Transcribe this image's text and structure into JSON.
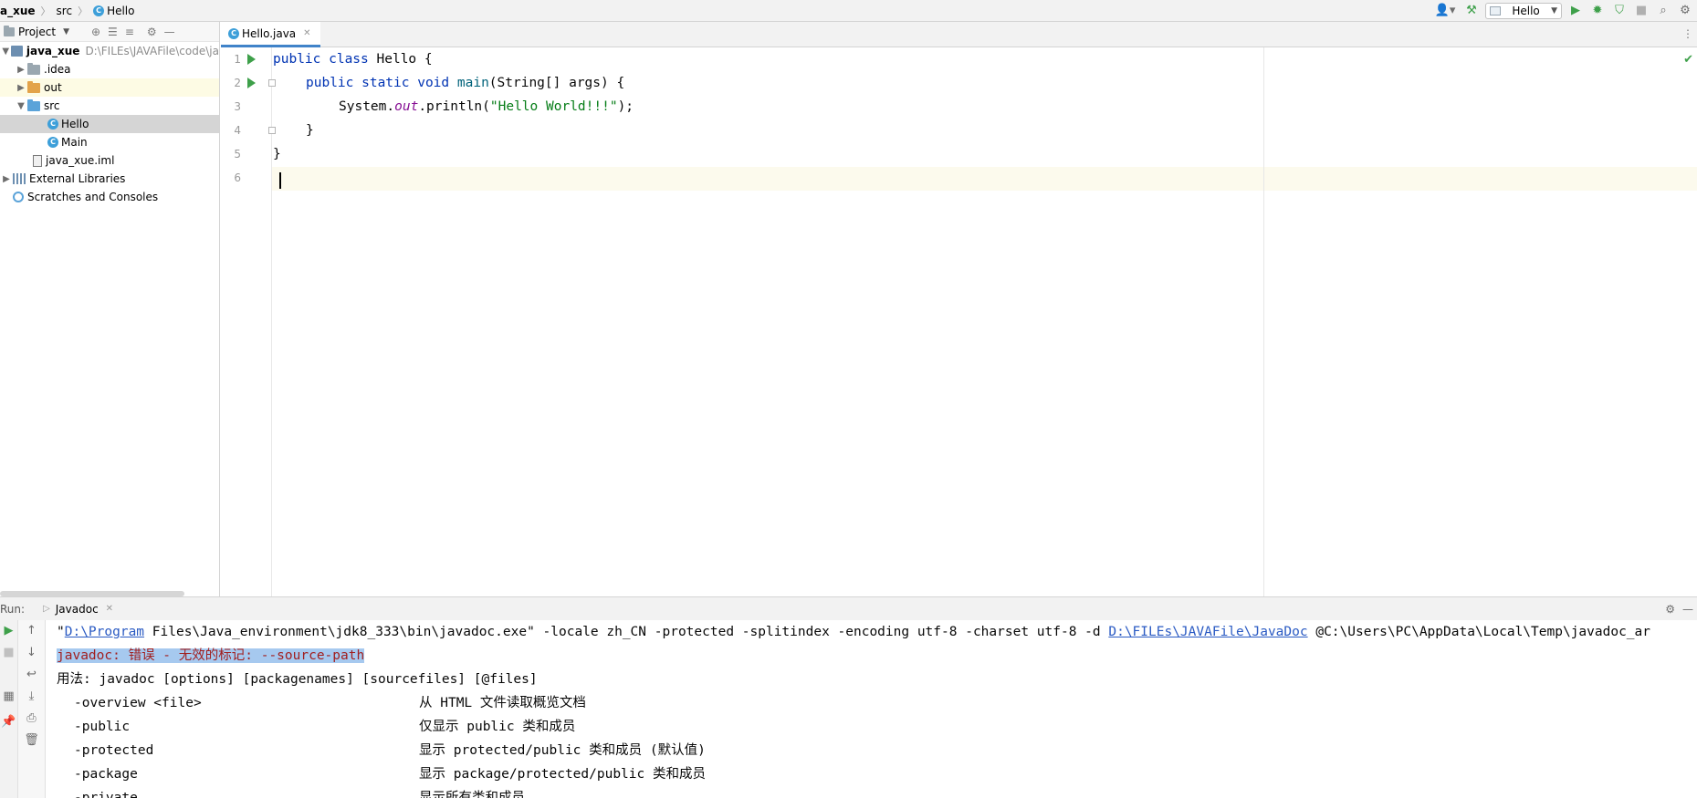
{
  "breadcrumb": [
    "a_xue",
    "src",
    "Hello"
  ],
  "run_config": {
    "label": "Hello"
  },
  "project": {
    "header_label": "Project",
    "root_name": "java_xue",
    "root_path": "D:\\FILEs\\JAVAFile\\code\\ja",
    "items": [
      {
        "label": ".idea"
      },
      {
        "label": "out"
      },
      {
        "label": "src"
      },
      {
        "label": "Hello"
      },
      {
        "label": "Main"
      },
      {
        "label": "java_xue.iml"
      },
      {
        "label": "External Libraries"
      },
      {
        "label": "Scratches and Consoles"
      }
    ]
  },
  "editor": {
    "tab_label": "Hello.java",
    "line_numbers": [
      "1",
      "2",
      "3",
      "4",
      "5",
      "6"
    ],
    "code": {
      "l1_kw": "public class ",
      "l1_rest": "Hello {",
      "l2_kw": "public static void ",
      "l2_fn": "main",
      "l2_rest": "(String[] args) {",
      "l3_a": "System.",
      "l3_field": "out",
      "l3_b": ".println(",
      "l3_str": "\"Hello World!!!\"",
      "l3_c": ");",
      "l4": "}",
      "l5": "}"
    }
  },
  "run_panel": {
    "run_label": "Run:",
    "tab_label": "Javadoc",
    "console": {
      "cmd_quote": "\"",
      "cmd_link1": "D:\\Program",
      "cmd_mid": " Files\\Java_environment\\jdk8_333\\bin\\javadoc.exe\" -locale zh_CN -protected -splitindex -encoding utf-8 -charset utf-8 -d ",
      "cmd_link2": "D:\\FILEs\\JAVAFile\\JavaDoc",
      "cmd_tail": " @C:\\Users\\PC\\AppData\\Local\\Temp\\javadoc_ar",
      "error": "javadoc: 错误 - 无效的标记: --source-path",
      "usage": "用法: javadoc [options] [packagenames] [sourcefiles] [@files]",
      "options": [
        {
          "flag": "-overview <file>",
          "desc": "从 HTML 文件读取概览文档"
        },
        {
          "flag": "-public",
          "desc": "仅显示 public 类和成员"
        },
        {
          "flag": "-protected",
          "desc": "显示 protected/public 类和成员 (默认值)"
        },
        {
          "flag": "-package",
          "desc": "显示 package/protected/public 类和成员"
        },
        {
          "flag": "-private",
          "desc": "显示所有类和成员"
        }
      ]
    }
  }
}
